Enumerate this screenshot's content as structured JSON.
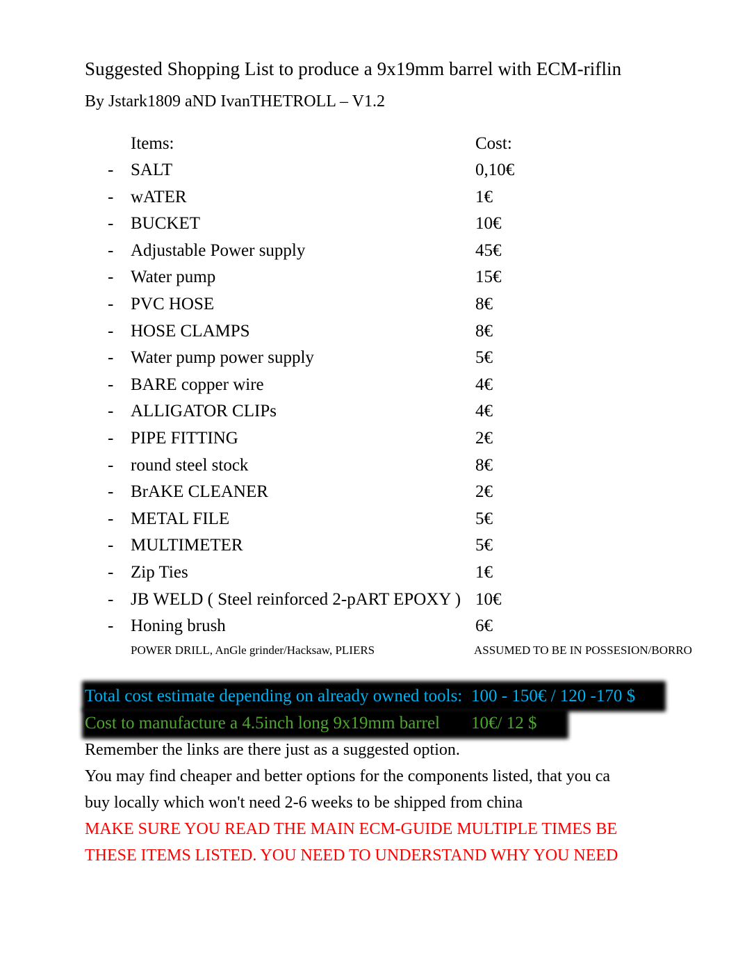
{
  "document": {
    "title": "Suggested Shopping List to produce a 9x19mm barrel with ECM-riflin",
    "byline": "By Jstark1809 aND IvanTHETROLL – V1.2"
  },
  "table": {
    "header_item": "Items:",
    "header_cost": "Cost:",
    "bullet": "-",
    "rows": [
      {
        "name": "SALT",
        "cost": "0,10€"
      },
      {
        "name": "wATER",
        "cost": "1€"
      },
      {
        "name": "BUCKET",
        "cost": "10€"
      },
      {
        "name": "Adjustable Power supply",
        "cost": "45€"
      },
      {
        "name": "Water pump",
        "cost": "15€"
      },
      {
        "name": "PVC HOSE",
        "cost": "8€"
      },
      {
        "name": "HOSE CLAMPS",
        "cost": "8€"
      },
      {
        "name": "Water pump power supply",
        "cost": "5€"
      },
      {
        "name": "BARE copper wire",
        "cost": "4€"
      },
      {
        "name": "ALLIGATOR CLIPs",
        "cost": "4€"
      },
      {
        "name": "PIPE FITTING",
        "cost": "2€"
      },
      {
        "name": "round steel stock",
        "cost": "8€"
      },
      {
        "name": "BrAKE CLEANER",
        "cost": "2€"
      },
      {
        "name": "METAL FILE",
        "cost": "5€"
      },
      {
        "name": "MULTIMETER",
        "cost": "5€"
      },
      {
        "name": "Zip Ties",
        "cost": "1€"
      },
      {
        "name": "JB WELD ( Steel reinforced 2-pART EPOXY )",
        "cost": "10€"
      },
      {
        "name": "Honing brush",
        "cost": "6€"
      }
    ]
  },
  "note": {
    "tools": "POWER DRILL, AnGle grinder/Hacksaw, PLIERS",
    "assumption": "ASSUMED TO BE IN POSSESION/BORRO"
  },
  "summary": {
    "total_label": "Total cost estimate depending on already owned tools:",
    "total_value": "100 - 150€ / 120 -170 $",
    "manufacture_label": "Cost to manufacture a 4.5inch long 9x19mm barrel",
    "manufacture_value": "10€/ 12 $",
    "total_color": "#00B0F0",
    "manufacture_color": "#4EA72E",
    "highlight_color": "#000000"
  },
  "body": {
    "line1": "Remember the links are there just as a suggested option.",
    "line2": "You may find cheaper and better options for the components listed, that you ca",
    "line3": "buy locally which won't need 2-6 weeks to be shipped from china"
  },
  "warning": {
    "line1": "MAKE SURE YOU READ THE MAIN ECM-GUIDE MULTIPLE TIMES BE",
    "line2": "THESE ITEMS LISTED. YOU NEED TO UNDERSTAND WHY YOU NEED",
    "color": "#FF0000"
  }
}
